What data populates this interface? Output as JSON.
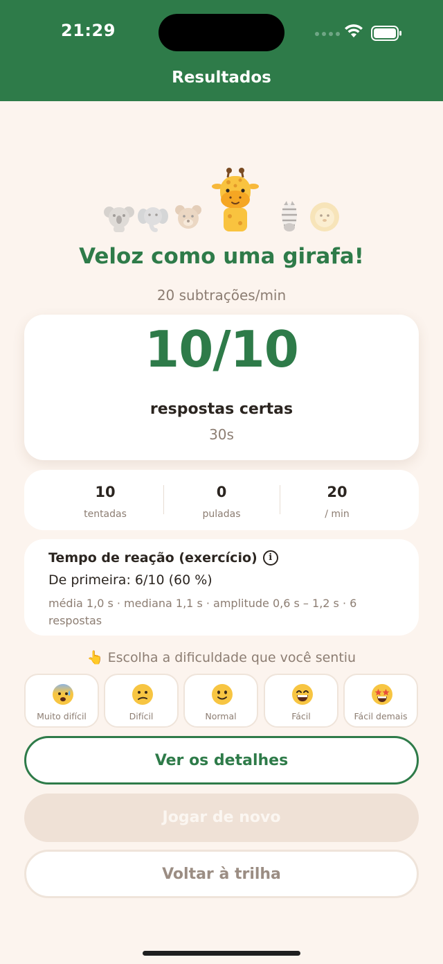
{
  "status_bar": {
    "time": "21:29"
  },
  "nav": {
    "title": "Resultados"
  },
  "result": {
    "headline": "Veloz como uma girafa!",
    "rate": "20 subtrações/min",
    "score": "10/10",
    "score_label": "respostas certas",
    "duration": "30s"
  },
  "stats": [
    {
      "value": "10",
      "label": "tentadas"
    },
    {
      "value": "0",
      "label": "puladas"
    },
    {
      "value": "20",
      "label": "/ min"
    }
  ],
  "reaction": {
    "title": "Tempo de reação (exercício)",
    "info_symbol": "i",
    "first_try": "De primeira: 6/10 (60 %)",
    "details": "média 1,0 s · mediana 1,1 s · amplitude 0,6 s – 1,2 s · 6 respostas"
  },
  "difficulty": {
    "prompt": "👆 Escolha a dificuldade que você sentiu",
    "options": [
      {
        "label": "Muito difícil",
        "icon": "anxious-face-icon"
      },
      {
        "label": "Difícil",
        "icon": "confused-face-icon"
      },
      {
        "label": "Normal",
        "icon": "slight-smile-face-icon"
      },
      {
        "label": "Fácil",
        "icon": "grin-face-icon"
      },
      {
        "label": "Fácil demais",
        "icon": "star-struck-face-icon"
      }
    ]
  },
  "buttons": {
    "details": "Ver os detalhes",
    "replay": "Jogar de novo",
    "back": "Voltar à trilha"
  },
  "colors": {
    "brand_green": "#2e7b49",
    "background": "#fcf4ee",
    "muted_text": "#8c7d72",
    "replay_disabled": "#efe1d6"
  }
}
